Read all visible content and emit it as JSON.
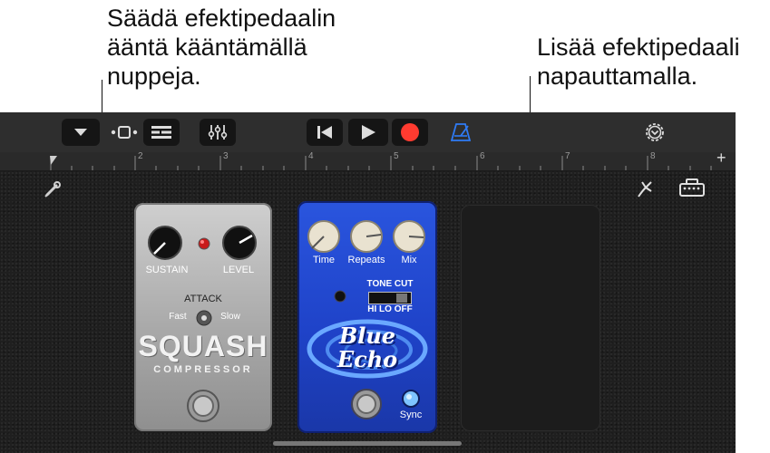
{
  "callouts": {
    "left": "Säädä efektipedaalin\nääntä kääntämällä\nnuppeja.",
    "right": "Lisää efektipedaali\nnapauttamalla."
  },
  "toolbar": {
    "icons": [
      "dropdown-icon",
      "track-view-icon",
      "tracks-list-icon",
      "mixer-icon",
      "rewind-icon",
      "play-icon",
      "record-icon",
      "metronome-icon",
      "settings-icon"
    ],
    "accent_color": "#2f7bf5",
    "record_color": "#ff3b30"
  },
  "ruler": {
    "marks": [
      "1",
      "2",
      "3",
      "4",
      "5",
      "6",
      "7",
      "8"
    ],
    "add_label": "+"
  },
  "squash": {
    "sustain_label": "SUSTAIN",
    "level_label": "LEVEL",
    "attack_label": "ATTACK",
    "fast_label": "Fast",
    "slow_label": "Slow",
    "brand": "SQUASH",
    "sub": "COMPRESSOR"
  },
  "blue_echo": {
    "time_label": "Time",
    "repeats_label": "Repeats",
    "mix_label": "Mix",
    "tone_cut_label": "TONE CUT",
    "hi_lo_label": "HI LO OFF",
    "brand_line1": "Blue",
    "brand_line2": "Echo",
    "sync_label": "Sync",
    "body_color": "#1f43c9"
  }
}
